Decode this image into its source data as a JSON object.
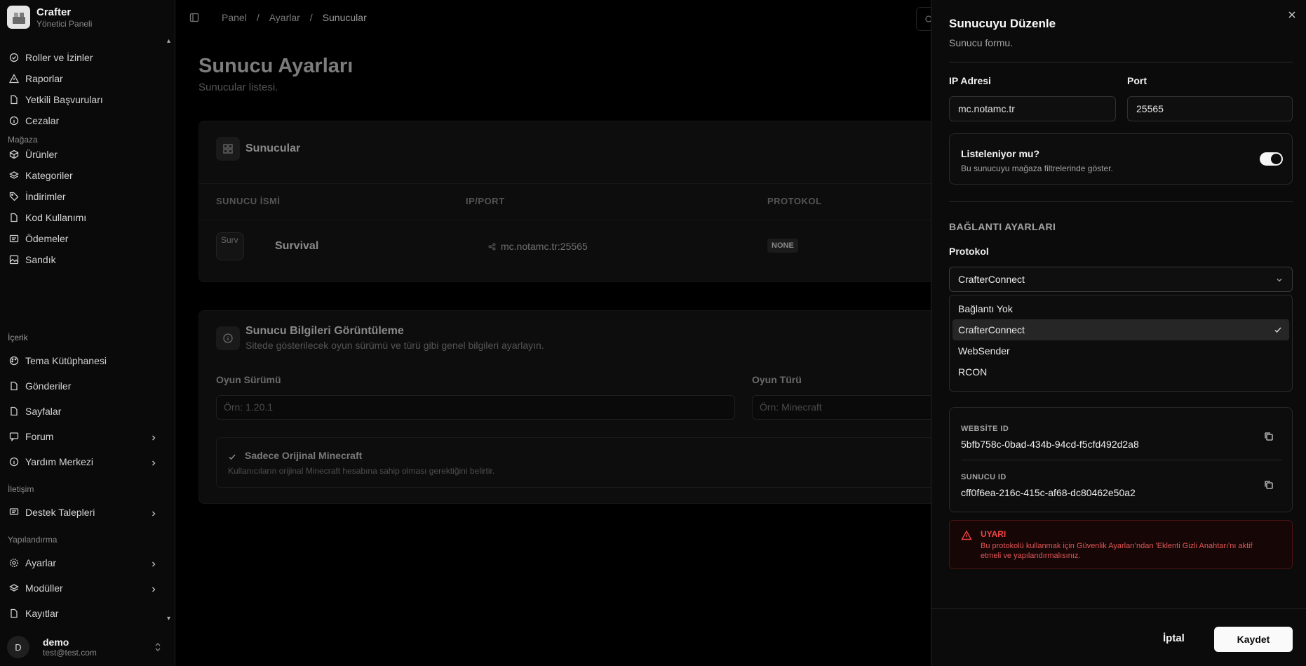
{
  "app": {
    "name": "Crafter",
    "subtitle": "Yönetici Paneli"
  },
  "sidebar": {
    "items": [
      {
        "label": "Roller ve İzinler",
        "icon": "shield-icon"
      },
      {
        "label": "Raporlar",
        "icon": "warning-icon"
      },
      {
        "label": "Yetkili Başvuruları",
        "icon": "file-icon"
      },
      {
        "label": "Cezalar",
        "icon": "info-icon"
      }
    ],
    "sections": [
      {
        "title": "Mağaza",
        "items": [
          {
            "label": "Ürünler",
            "icon": "box-icon"
          },
          {
            "label": "Kategoriler",
            "icon": "layers-icon"
          },
          {
            "label": "İndirimler",
            "icon": "tag-icon"
          },
          {
            "label": "Kod Kullanımı",
            "icon": "file-icon"
          },
          {
            "label": "Ödemeler",
            "icon": "receipt-icon"
          },
          {
            "label": "Sandık",
            "icon": "image-icon"
          }
        ]
      },
      {
        "title": "İçerik",
        "items": [
          {
            "label": "Tema Kütüphanesi",
            "icon": "palette-icon"
          },
          {
            "label": "Gönderiler",
            "icon": "file-icon"
          },
          {
            "label": "Sayfalar",
            "icon": "file-icon"
          },
          {
            "label": "Forum",
            "icon": "message-icon"
          },
          {
            "label": "Yardım Merkezi",
            "icon": "help-icon"
          }
        ]
      },
      {
        "title": "İletişim",
        "items": [
          {
            "label": "Destek Talepleri",
            "icon": "message-icon"
          }
        ]
      },
      {
        "title": "Yapılandırma",
        "items": [
          {
            "label": "Ayarlar",
            "icon": "gear-icon"
          },
          {
            "label": "Modüller",
            "icon": "layers-icon"
          },
          {
            "label": "Kayıtlar",
            "icon": "file-icon"
          }
        ]
      }
    ]
  },
  "user": {
    "initial": "D",
    "name": "demo",
    "email": "test@test.com"
  },
  "breadcrumb": [
    "Panel",
    "Ayarlar",
    "Sunucular"
  ],
  "page": {
    "title": "Sunucu Ayarları",
    "subtitle": "Sunucular listesi."
  },
  "servers_card": {
    "title": "Sunucular",
    "columns": [
      "SUNUCU İSMİ",
      "IP/PORT",
      "PROTOKOL"
    ],
    "rows": [
      {
        "name": "Survival",
        "image_alt": "Surv",
        "address": "mc.notamc.tr:25565",
        "protocol": "NONE"
      }
    ]
  },
  "info_card": {
    "title": "Sunucu Bilgileri Görüntüleme",
    "desc": "Sitede gösterilecek oyun sürümü ve türü gibi genel bilgileri ayarlayın.",
    "version_label": "Oyun Sürümü",
    "version_placeholder": "Örn: 1.20.1",
    "type_label": "Oyun Türü",
    "type_placeholder": "Örn: Minecraft",
    "premium_title": "Sadece Orijinal Minecraft",
    "premium_desc": "Kullanıcıların orijinal Minecraft hesabına sahip olması gerektiğini belirtir."
  },
  "drawer": {
    "title": "Sunucuyu Düzenle",
    "subtitle": "Sunucu formu.",
    "ip_label": "IP Adresi",
    "ip_value": "mc.notamc.tr",
    "port_label": "Port",
    "port_value": "25565",
    "listed_title": "Listeleniyor mu?",
    "listed_desc": "Bu sunucuyu mağaza filtrelerinde göster.",
    "listed_on": true,
    "connection_section": "BAĞLANTI AYARLARI",
    "protocol_label": "Protokol",
    "protocol_value": "CrafterConnect",
    "protocol_options": [
      "Bağlantı Yok",
      "CrafterConnect",
      "WebSender",
      "RCON"
    ],
    "website_id_label": "WEBSİTE ID",
    "website_id": "5bfb758c-0bad-434b-94cd-f5cfd492d2a8",
    "server_id_label": "SUNUCU ID",
    "server_id": "cff0f6ea-216c-415c-af68-dc80462e50a2",
    "warning_title": "UYARI",
    "warning_text": "Bu protokolü kullanmak için Güvenlik Ayarları'ndan 'Eklenti Gizli Anahtarı'nı aktif etmeli ve yapılandırmalısınız.",
    "cancel_label": "İptal",
    "save_label": "Kaydet"
  }
}
